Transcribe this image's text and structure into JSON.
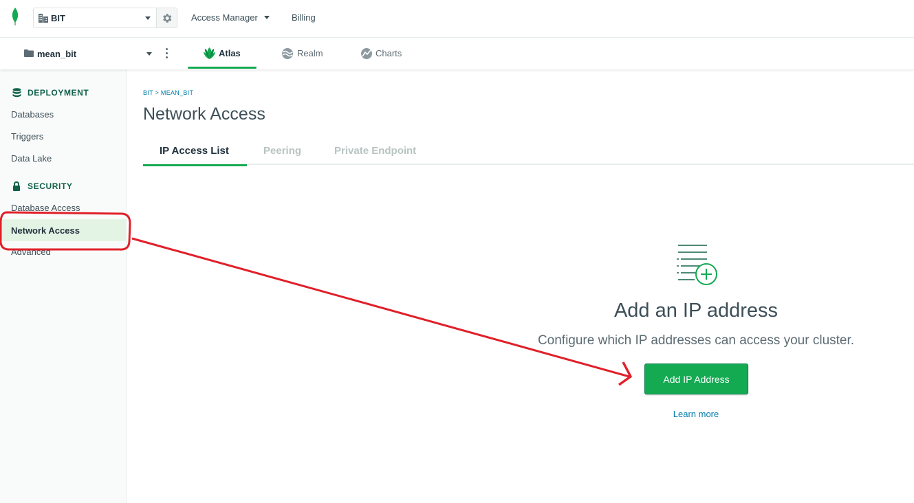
{
  "org": {
    "name": "BIT"
  },
  "top_nav": {
    "access_manager": "Access Manager",
    "billing": "Billing"
  },
  "project": {
    "name": "mean_bit"
  },
  "product_tabs": [
    {
      "label": "Atlas",
      "active": true
    },
    {
      "label": "Realm",
      "active": false
    },
    {
      "label": "Charts",
      "active": false
    }
  ],
  "sidebar": {
    "deployment": {
      "heading": "DEPLOYMENT",
      "items": [
        "Databases",
        "Triggers",
        "Data Lake"
      ]
    },
    "security": {
      "heading": "SECURITY",
      "items": [
        "Database Access",
        "Network Access",
        "Advanced"
      ],
      "active": "Network Access"
    }
  },
  "main": {
    "breadcrumb": "BIT > MEAN_BIT",
    "title": "Network Access",
    "tabs": [
      {
        "label": "IP Access List",
        "active": true
      },
      {
        "label": "Peering",
        "active": false
      },
      {
        "label": "Private Endpoint",
        "active": false
      }
    ],
    "empty_state": {
      "title": "Add an IP address",
      "description": "Configure which IP addresses can access your cluster.",
      "button": "Add IP Address",
      "link": "Learn more"
    }
  },
  "colors": {
    "brand_green": "#13aa52",
    "dark_green": "#116149",
    "link_blue": "#007cad",
    "annotation_red": "#e0202a"
  },
  "icons": [
    "mongodb-leaf-icon",
    "building-icon",
    "gear-icon",
    "folder-icon",
    "kebab-icon",
    "atlas-icon",
    "realm-icon",
    "charts-icon",
    "database-icon",
    "lock-icon",
    "ip-list-add-icon"
  ]
}
